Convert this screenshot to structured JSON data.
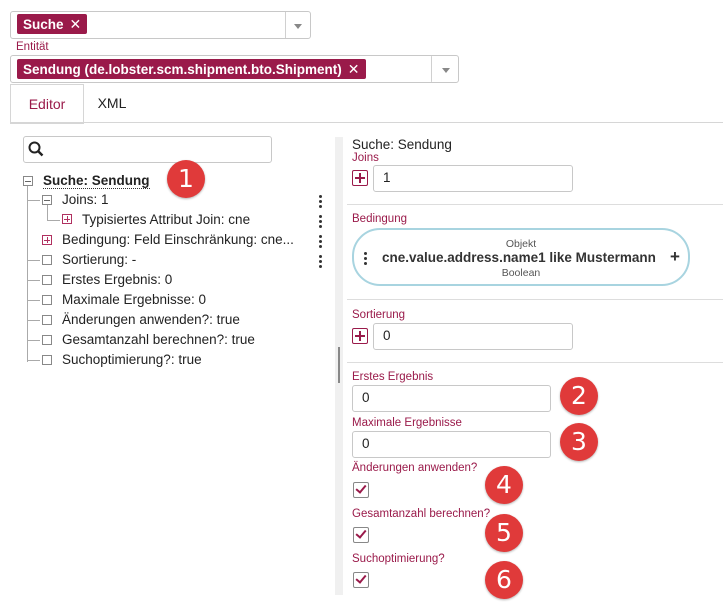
{
  "top_select": {
    "chip_label": "Suche"
  },
  "entity": {
    "label": "Entität",
    "chip_label": "Sendung (de.lobster.scm.shipment.bto.Shipment)"
  },
  "tabs": [
    {
      "label": "Editor",
      "active": true
    },
    {
      "label": "XML",
      "active": false
    }
  ],
  "tree": {
    "search_placeholder": "",
    "items": [
      {
        "label": "Suche: Sendung"
      },
      {
        "label": "Joins: 1"
      },
      {
        "label": "Typisiertes Attribut Join: cne"
      },
      {
        "label": "Bedingung: Feld Einschränkung: cne..."
      },
      {
        "label": "Sortierung: -"
      },
      {
        "label": "Erstes Ergebnis: 0"
      },
      {
        "label": "Maximale Ergebnisse: 0"
      },
      {
        "label": "Änderungen anwenden?: true"
      },
      {
        "label": "Gesamtanzahl berechnen?: true"
      },
      {
        "label": "Suchoptimierung?: true"
      }
    ]
  },
  "detail": {
    "title": "Suche: Sendung",
    "joins_label": "Joins",
    "joins_value": "1",
    "condition_label": "Bedingung",
    "condition_top": "Objekt",
    "condition_main": "cne.value.address.name1 like Mustermann",
    "condition_bottom": "Boolean",
    "sort_label": "Sortierung",
    "sort_value": "0",
    "first_result_label": "Erstes Ergebnis",
    "first_result_value": "0",
    "max_results_label": "Maximale Ergebnisse",
    "max_results_value": "0",
    "apply_changes_label": "Änderungen anwenden?",
    "apply_changes_checked": true,
    "count_total_label": "Gesamtanzahl berechnen?",
    "count_total_checked": true,
    "search_opt_label": "Suchoptimierung?",
    "search_opt_checked": true
  },
  "annotations": [
    "1",
    "2",
    "3",
    "4",
    "5",
    "6"
  ],
  "colors": {
    "accent": "#9a1a4a",
    "badge": "#e03a3a",
    "condition_border": "#a8d4e0"
  }
}
